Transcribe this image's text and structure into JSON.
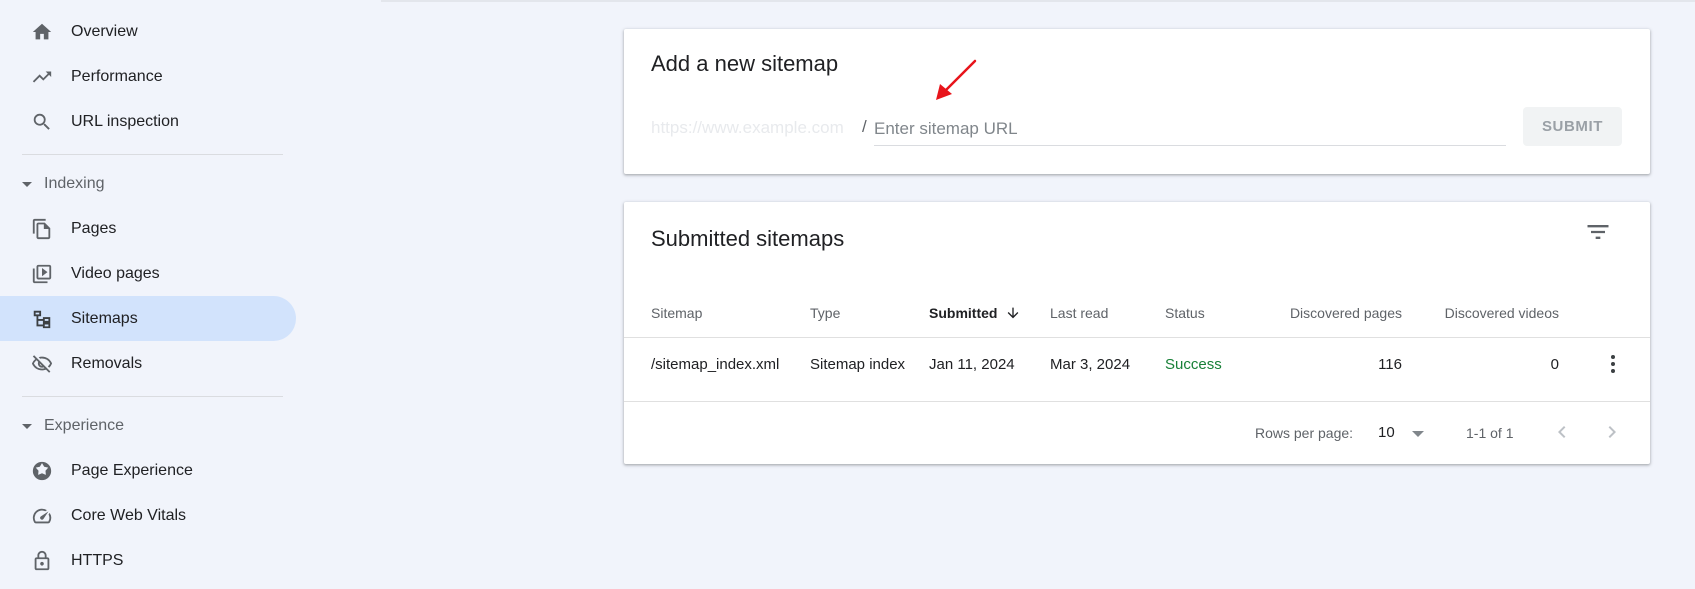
{
  "nav": {
    "top_items": [
      {
        "label": "Overview",
        "icon": "home-icon"
      },
      {
        "label": "Performance",
        "icon": "trending-up-icon"
      },
      {
        "label": "URL inspection",
        "icon": "search-icon"
      }
    ],
    "indexing_header": "Indexing",
    "indexing_items": [
      {
        "label": "Pages",
        "icon": "pages-icon"
      },
      {
        "label": "Video pages",
        "icon": "video-pages-icon"
      },
      {
        "label": "Sitemaps",
        "icon": "sitemap-icon",
        "active": true
      },
      {
        "label": "Removals",
        "icon": "visibility-off-icon"
      }
    ],
    "experience_header": "Experience",
    "experience_items": [
      {
        "label": "Page Experience",
        "icon": "page-experience-icon"
      },
      {
        "label": "Core Web Vitals",
        "icon": "speed-gauge-icon"
      },
      {
        "label": "HTTPS",
        "icon": "lock-icon"
      }
    ]
  },
  "add_sitemap": {
    "title": "Add a new sitemap",
    "url_prefix": "https://www.example.com",
    "slash": "/",
    "input_placeholder": "Enter sitemap URL",
    "input_value": "",
    "submit_label": "SUBMIT"
  },
  "submitted": {
    "title": "Submitted sitemaps",
    "columns": [
      "Sitemap",
      "Type",
      "Submitted",
      "Last read",
      "Status",
      "Discovered pages",
      "Discovered videos"
    ],
    "rows": [
      {
        "sitemap": "/sitemap_index.xml",
        "type": "Sitemap index",
        "submitted": "Jan 11, 2024",
        "last_read": "Mar 3, 2024",
        "status": "Success",
        "pages": "116",
        "videos": "0"
      }
    ],
    "footer": {
      "rows_per_page_label": "Rows per page:",
      "rows_per_page_value": "10",
      "range": "1-1 of 1"
    }
  },
  "colors": {
    "active_nav_bg": "#d2e3fc",
    "status_success": "#188038",
    "annotation_arrow": "#e8141b"
  }
}
